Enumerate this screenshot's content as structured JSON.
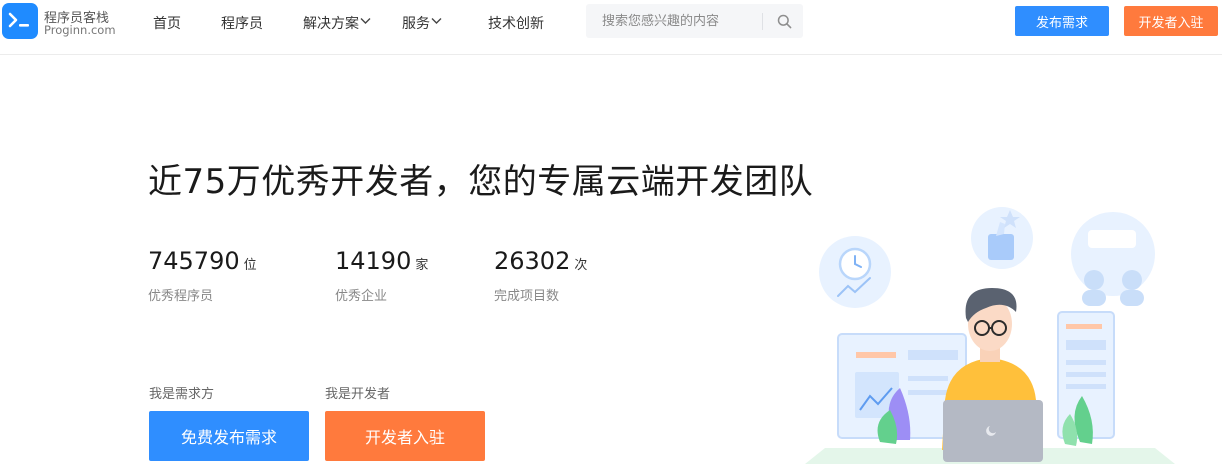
{
  "header": {
    "logo": {
      "glyph": ">_",
      "name": "程序员客栈",
      "domain": "Proginn.com"
    },
    "nav": [
      {
        "label": "首页",
        "has_dropdown": false
      },
      {
        "label": "程序员",
        "has_dropdown": false
      },
      {
        "label": "解决方案",
        "has_dropdown": true
      },
      {
        "label": "服务",
        "has_dropdown": true
      },
      {
        "label": "技术创新",
        "has_dropdown": false
      }
    ],
    "search": {
      "placeholder": "搜索您感兴趣的内容",
      "value": ""
    },
    "post_button": "发布需求",
    "join_button": "开发者入驻"
  },
  "hero": {
    "headline": "近75万优秀开发者，您的专属云端开发团队",
    "stats": [
      {
        "value": "745790",
        "unit": "位",
        "label": "优秀程序员"
      },
      {
        "value": "14190",
        "unit": "家",
        "label": "优秀企业"
      },
      {
        "value": "26302",
        "unit": "次",
        "label": "完成项目数"
      }
    ],
    "client_label": "我是需求方",
    "developer_label": "我是开发者",
    "client_cta": "免费发布需求",
    "developer_cta": "开发者入驻"
  },
  "colors": {
    "brand_blue": "#2f8eff",
    "brand_orange": "#ff7a3d"
  },
  "icons": [
    "logo-terminal-icon",
    "chevron-down-icon",
    "search-icon",
    "developer-illustration"
  ]
}
